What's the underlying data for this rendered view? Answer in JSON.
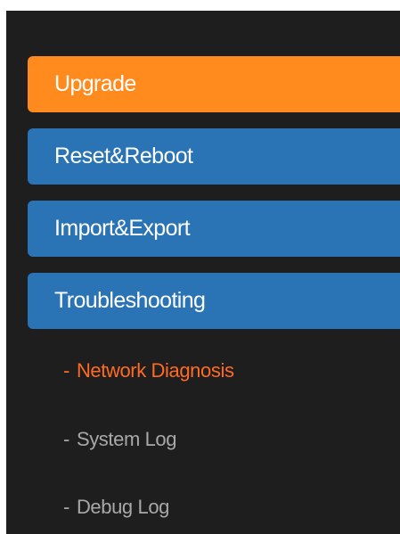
{
  "menu": {
    "items": [
      {
        "label": "Upgrade",
        "state": "active"
      },
      {
        "label": "Reset&Reboot",
        "state": "normal"
      },
      {
        "label": "Import&Export",
        "state": "normal"
      },
      {
        "label": "Troubleshooting",
        "state": "normal"
      }
    ],
    "subitems": [
      {
        "prefix": "-",
        "label": "Network Diagnosis",
        "state": "active"
      },
      {
        "prefix": "-",
        "label": "System Log",
        "state": "normal"
      },
      {
        "prefix": "-",
        "label": "Debug Log",
        "state": "normal"
      }
    ]
  },
  "colors": {
    "background": "#1e1e1e",
    "active_item": "#ff8a1e",
    "normal_item": "#2a73b4",
    "active_subitem_text": "#ff6a24",
    "subitem_text": "#a8a8a8"
  }
}
